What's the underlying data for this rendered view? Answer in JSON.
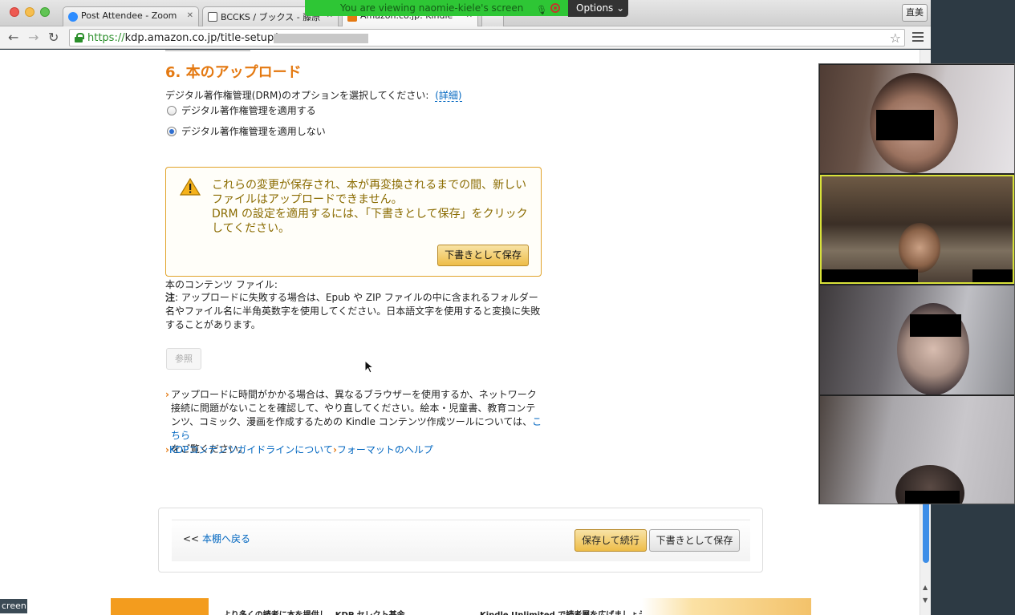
{
  "browser": {
    "tabs": [
      {
        "label": "Post Attendee - Zoom",
        "close": "✕"
      },
      {
        "label": "BCCKS / ブックス - 藤原",
        "close": "✕"
      },
      {
        "label": "Amazon.co.jp: Kindle",
        "close": "✕"
      }
    ],
    "profile_label": "直美",
    "url_scheme": "https://",
    "url_host": "kdp.amazon.co.jp",
    "url_path": "/title-setup/"
  },
  "zoom": {
    "banner_text": "You are viewing naomie-kiele's screen",
    "options_label": "Options",
    "screen_label": "creen"
  },
  "page": {
    "section_title": "6. 本のアップロード",
    "drm_question": "デジタル著作権管理(DRM)のオプションを選択してください:",
    "drm_detail_link": "(詳細)",
    "radio_apply": "デジタル著作権管理を適用する",
    "radio_noapply": "デジタル著作権管理を適用しない",
    "alert": {
      "line1": "これらの変更が保存され、本が再変換されるまでの間、新しいファイルはアップロードできません。",
      "line2": "DRM の設定を適用するには、「下書きとして保存」をクリックしてください。",
      "button": "下書きとして保存"
    },
    "content_files_label": "本のコンテンツ ファイル:",
    "note_label": "注",
    "note_text": ": アップロードに失敗する場合は、Epub や ZIP ファイルの中に含まれるフォルダー名やファイル名に半角英数字を使用してください。日本語文字を使用すると変換に失敗することがあります。",
    "browse_button": "参照",
    "help_text": "アップロードに時間がかかる場合は、異なるブラウザーを使用するか、ネットワーク接続に問題がないことを確認して、やり直してください。絵本・児童書、教育コンテンツ、コミック、漫画を作成するための Kindle コンテンツ作成ツールについては、",
    "help_link": "こちら",
    "help_tail": "をご覧ください。",
    "guide_link": "KDPコンテンツガイドラインについて",
    "format_link": "フォーマットのヘルプ",
    "back_prefix": "<< ",
    "back_link": "本棚へ戻る",
    "save_continue": "保存して続行",
    "save_draft": "下書きとして保存",
    "promo1": "より多くの読者に本を提供し、KDP セレクト基金",
    "promo2": "Kindle Unlimited で読者層を広げましょう"
  },
  "colors": {
    "accent_orange": "#e47911",
    "link_blue": "#0066c0",
    "zoom_green": "#2ec635",
    "active_speaker": "#d9e23a"
  }
}
